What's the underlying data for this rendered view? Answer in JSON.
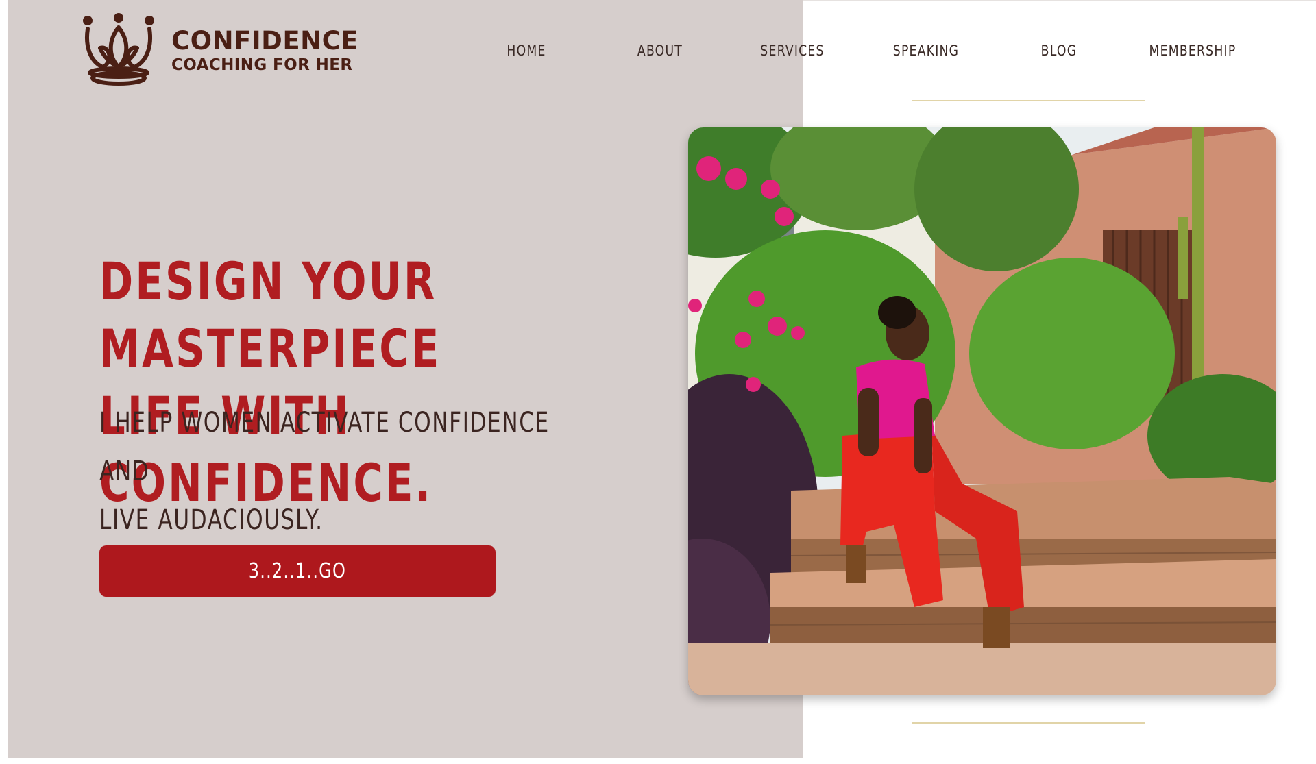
{
  "brand": {
    "name_line1": "CONFIDENCE",
    "name_line2": "COACHING FOR HER",
    "icon": "crown-icon",
    "color": "#4a1f14"
  },
  "nav": {
    "items": [
      {
        "label": "HOME"
      },
      {
        "label": "ABOUT"
      },
      {
        "label": "SERVICES"
      },
      {
        "label": "SPEAKING"
      },
      {
        "label": "BLOG"
      },
      {
        "label": "MEMBERSHIP"
      }
    ]
  },
  "hero": {
    "headline_line1": "DESIGN YOUR MASTERPIECE",
    "headline_line2": "LIFE WITH CONFIDENCE.",
    "subhead_line1": "I HELP WOMEN ACTIVATE CONFIDENCE AND",
    "subhead_line2": "LIVE AUDACIOUSLY.",
    "cta_label": "3..2..1..GO",
    "image": "photo of woman in pink top and red trousers seated on garden stone steps"
  },
  "colors": {
    "panel_bg": "#d6cecc",
    "accent_red": "#b01d21",
    "rule_gold": "#e1d4a8",
    "text_dark": "#3b2420"
  }
}
